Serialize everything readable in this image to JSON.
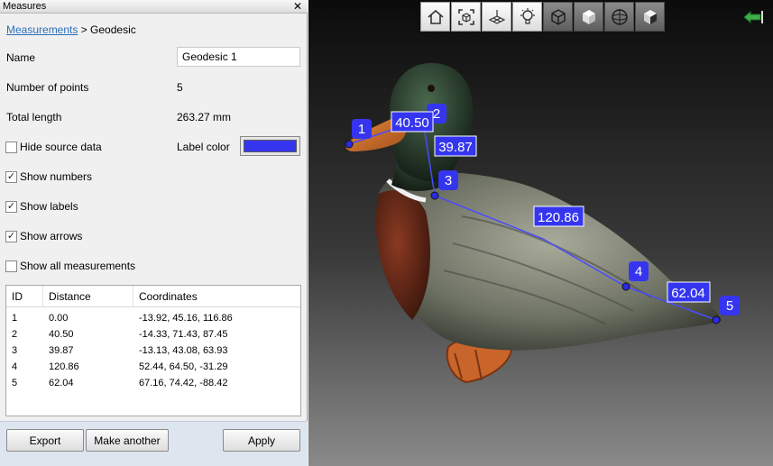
{
  "panel": {
    "title": "Measures",
    "close": "✕",
    "breadcrumb_link": "Measurements",
    "breadcrumb_rest": " > Geodesic",
    "name_label": "Name",
    "name_value": "Geodesic 1",
    "points_label": "Number of points",
    "points_value": "5",
    "length_label": "Total length",
    "length_value": "263.27 mm",
    "label_color_label": "Label color",
    "label_color": "#3535f0",
    "checkboxes": {
      "hide_source": {
        "label": "Hide source data",
        "checked": false
      },
      "show_numbers": {
        "label": "Show numbers",
        "checked": true
      },
      "show_labels": {
        "label": "Show labels",
        "checked": true
      },
      "show_arrows": {
        "label": "Show arrows",
        "checked": true
      },
      "show_all": {
        "label": "Show all measurements",
        "checked": false
      }
    },
    "table": {
      "headers": [
        "ID",
        "Distance",
        "Coordinates"
      ],
      "rows": [
        {
          "id": "1",
          "distance": "0.00",
          "coords": "-13.92, 45.16, 116.86"
        },
        {
          "id": "2",
          "distance": "40.50",
          "coords": "-14.33, 71.43, 87.45"
        },
        {
          "id": "3",
          "distance": "39.87",
          "coords": "-13.13, 43.08, 63.93"
        },
        {
          "id": "4",
          "distance": "120.86",
          "coords": "52.44, 64.50, -31.29"
        },
        {
          "id": "5",
          "distance": "62.04",
          "coords": "67.16, 74.42, -88.42"
        }
      ]
    },
    "buttons": {
      "export": "Export",
      "make_another": "Make another",
      "apply": "Apply"
    }
  },
  "viewport": {
    "toolbar": [
      "home-icon",
      "fit-view-icon",
      "grid-icon",
      "light-bulb-icon",
      "wireframe-cube-icon",
      "solid-cube-icon",
      "sphere-icon",
      "textured-cube-icon"
    ],
    "point_labels": [
      "1",
      "2",
      "3",
      "4",
      "5"
    ],
    "segment_labels": [
      "40.50",
      "39.87",
      "120.86",
      "62.04"
    ],
    "marker_color": "#3535f0"
  }
}
